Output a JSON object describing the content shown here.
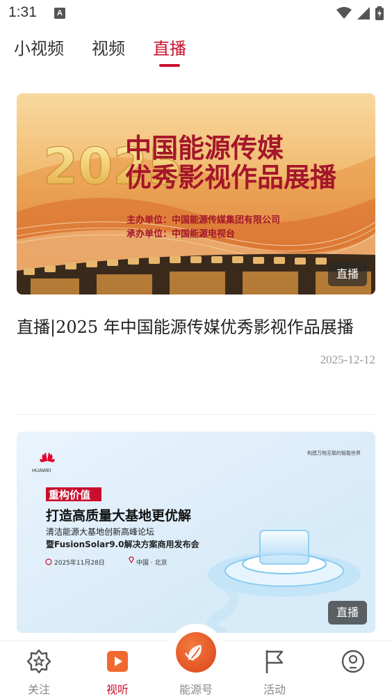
{
  "status_bar": {
    "time": "1:31",
    "notification_icon": "a-letter-icon",
    "icons": [
      "wifi-icon",
      "signal-icon",
      "battery-icon"
    ]
  },
  "tabs": [
    {
      "label": "小视频",
      "active": false
    },
    {
      "label": "视频",
      "active": false
    },
    {
      "label": "直播",
      "active": true
    }
  ],
  "accent_color": "#c8102e",
  "feed": [
    {
      "thumbnail": {
        "year": "2025",
        "headline_line1": "中国能源传媒",
        "headline_line2": "优秀影视作品展播",
        "host_line": "主办单位：中国能源传媒集团有限公司",
        "organizer_line": "承办单位：中国能源电视台"
      },
      "badge": "直播",
      "title": "直播|2025 年中国能源传媒优秀影视作品展播",
      "date": "2025-12-12"
    },
    {
      "thumbnail": {
        "brand": "HUAWEI",
        "slogan": "构建万物互联的智能世界",
        "tag": "重构价值",
        "headline": "打造高质量大基地更优解",
        "sub1": "清洁能源大基地创新高峰论坛",
        "sub2": "暨FusionSolar9.0解决方案商用发布会",
        "date": "2025年11月28日",
        "location": "中国 · 北京"
      },
      "badge": "直播"
    }
  ],
  "bottom_nav": [
    {
      "label": "关注",
      "icon": "star-badge-icon",
      "active": false
    },
    {
      "label": "视听",
      "icon": "play-icon",
      "active": true
    },
    {
      "label": "能源号",
      "icon": "leaf-icon",
      "active": false
    },
    {
      "label": "活动",
      "icon": "flag-icon",
      "active": false
    },
    {
      "label": "",
      "icon": "profile-icon",
      "active": false
    }
  ]
}
